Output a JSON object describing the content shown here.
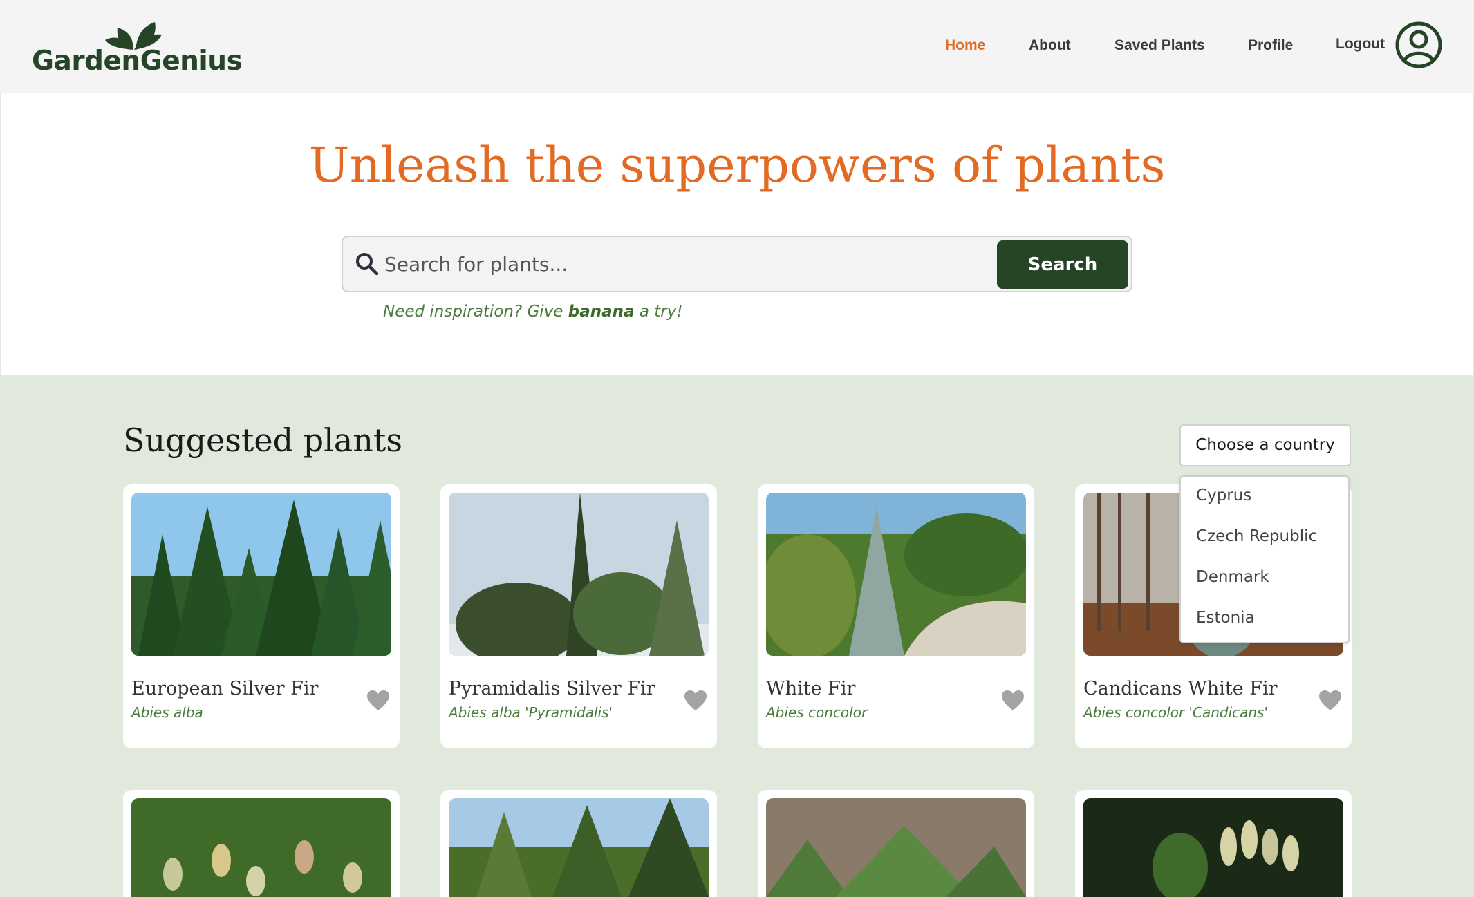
{
  "brand": {
    "name_part1": "Garden",
    "name_part2": "Genius"
  },
  "nav": {
    "home": "Home",
    "about": "About",
    "saved": "Saved Plants",
    "profile": "Profile",
    "logout": "Logout"
  },
  "hero": {
    "title": "Unleash the superpowers of plants",
    "search_placeholder": "Search for plants...",
    "search_button": "Search",
    "inspiration_prefix": "Need inspiration? Give ",
    "inspiration_word": "banana",
    "inspiration_suffix": " a try!"
  },
  "suggestions": {
    "title": "Suggested plants",
    "country_button": "Choose a country",
    "countries": [
      "Cyprus",
      "Czech Republic",
      "Denmark",
      "Estonia"
    ],
    "cards": [
      {
        "name": "European Silver Fir",
        "scientific": "Abies alba"
      },
      {
        "name": "Pyramidalis Silver Fir",
        "scientific": "Abies alba 'Pyramidalis'"
      },
      {
        "name": "White Fir",
        "scientific": "Abies concolor"
      },
      {
        "name": "Candicans White Fir",
        "scientific": "Abies concolor 'Candicans'"
      }
    ]
  },
  "colors": {
    "brand_green": "#264426",
    "accent_orange": "#e26a23",
    "section_bg": "#e1e8dc",
    "scientific_green": "#4a7a3c"
  },
  "icons": {
    "search": "search-icon",
    "avatar": "user-circle-icon",
    "heart": "heart-icon",
    "logo_leaves": "leaves-icon"
  }
}
